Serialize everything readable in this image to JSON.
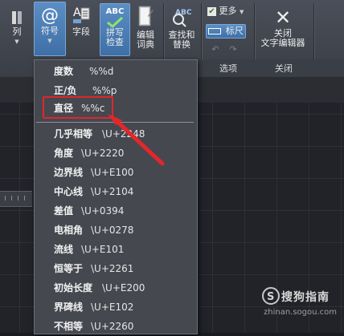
{
  "ribbon": {
    "col_label": "列",
    "symbol_label": "符号",
    "field_label": "字段",
    "spell_check_label": "拼写\n检查",
    "spell_icon_text": "ABC",
    "edit_dict_label": "编辑\n词典",
    "find_replace_label": "查找和\n替换",
    "find_icon_text": "ABC",
    "more_label": "更多",
    "ruler_label": "标尺",
    "close_editor_label": "关闭\n文字编辑器",
    "group_options": "选项",
    "group_close": "关闭"
  },
  "menu": {
    "top_items": [
      {
        "name": "度数",
        "code": "%%d"
      },
      {
        "name": "正/负",
        "code": "%%p"
      },
      {
        "name": "直径",
        "code": "%%c"
      }
    ],
    "items": [
      {
        "name": "几乎相等",
        "code": "\\U+2248"
      },
      {
        "name": "角度",
        "code": "\\U+2220"
      },
      {
        "name": "边界线",
        "code": "\\U+E100"
      },
      {
        "name": "中心线",
        "code": "\\U+2104"
      },
      {
        "name": "差值",
        "code": "\\U+0394"
      },
      {
        "name": "电相角",
        "code": "\\U+0278"
      },
      {
        "name": "流线",
        "code": "\\U+E101"
      },
      {
        "name": "恒等于",
        "code": "\\U+2261"
      },
      {
        "name": "初始长度",
        "code": "\\U+E200"
      },
      {
        "name": "界碑线",
        "code": "\\U+E102"
      },
      {
        "name": "不相等",
        "code": "\\U+2260"
      }
    ]
  },
  "watermark": {
    "brand": "搜狗指南",
    "url": "zhinan.sogou.com"
  },
  "colors": {
    "highlight": "#e0262b",
    "active_button": "#4a7fb8"
  }
}
